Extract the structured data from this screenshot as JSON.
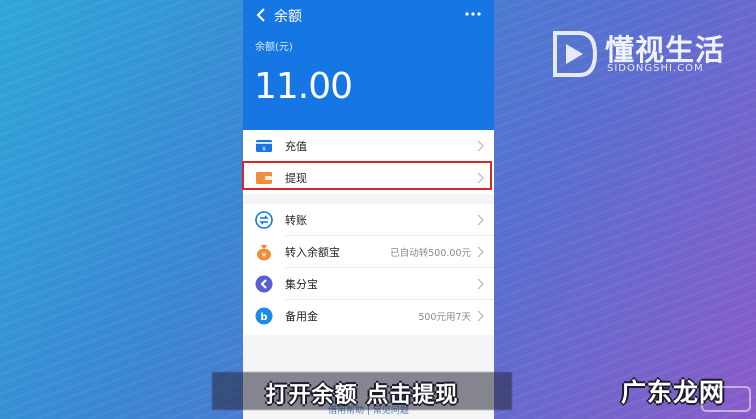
{
  "watermark": {
    "title": "懂视生活",
    "subtitle": "SIDONGSHI.COM"
  },
  "header": {
    "nav_title": "余额",
    "balance_label": "余额(元)",
    "balance_value": "11.00"
  },
  "group1": [
    {
      "label": "充值",
      "icon": "recharge-card-icon",
      "color": "#1677e4"
    },
    {
      "label": "提现",
      "icon": "wallet-icon",
      "color": "#f08c3c"
    }
  ],
  "group2": [
    {
      "label": "转账",
      "value": "",
      "icon": "transfer-icon",
      "color": "#1677e4"
    },
    {
      "label": "转入余额宝",
      "value": "已自动转500.00元",
      "icon": "money-bag-icon",
      "color": "#f08c3c"
    },
    {
      "label": "集分宝",
      "value": "",
      "icon": "points-icon",
      "color": "#5b5fd6"
    },
    {
      "label": "备用金",
      "value": "500元用7天",
      "icon": "reserve-fund-icon",
      "color": "#1a8ce8"
    }
  ],
  "bottom_links": "借用帮助  |  常见问题",
  "subtitle": "打开余额  点击提现",
  "corner_brand": "广东龙网",
  "colors": {
    "header_blue": "#1677e4",
    "highlight_red": "#d9262c"
  }
}
